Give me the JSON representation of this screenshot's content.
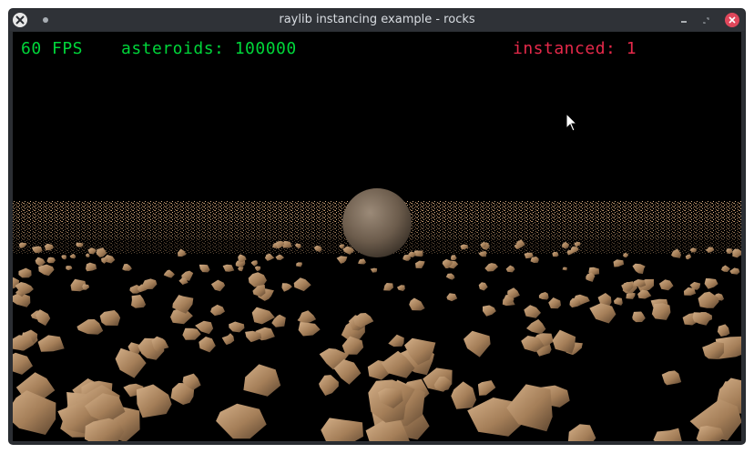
{
  "window": {
    "title": "raylib instancing example - rocks"
  },
  "hud": {
    "fps_value": "60",
    "fps_label": "FPS",
    "fps_text": "60 FPS",
    "asteroids_label": "asteroids:",
    "asteroids_count": "100000",
    "asteroids_text": "asteroids: 100000",
    "instanced_label": "instanced:",
    "instanced_value": "1",
    "instanced_text": "instanced: 1"
  },
  "colors": {
    "hud_green": "#00d63a",
    "hud_red": "#e6294a",
    "rock": "#b58f6a",
    "planet": "#7a6a5a",
    "background": "#000000"
  },
  "icons": {
    "window_menu": "close-x-icon",
    "pin": "pin-dot-icon",
    "minimize": "minimize-icon",
    "restore": "restore-icon",
    "close": "close-x-icon",
    "cursor": "mouse-cursor-icon"
  }
}
